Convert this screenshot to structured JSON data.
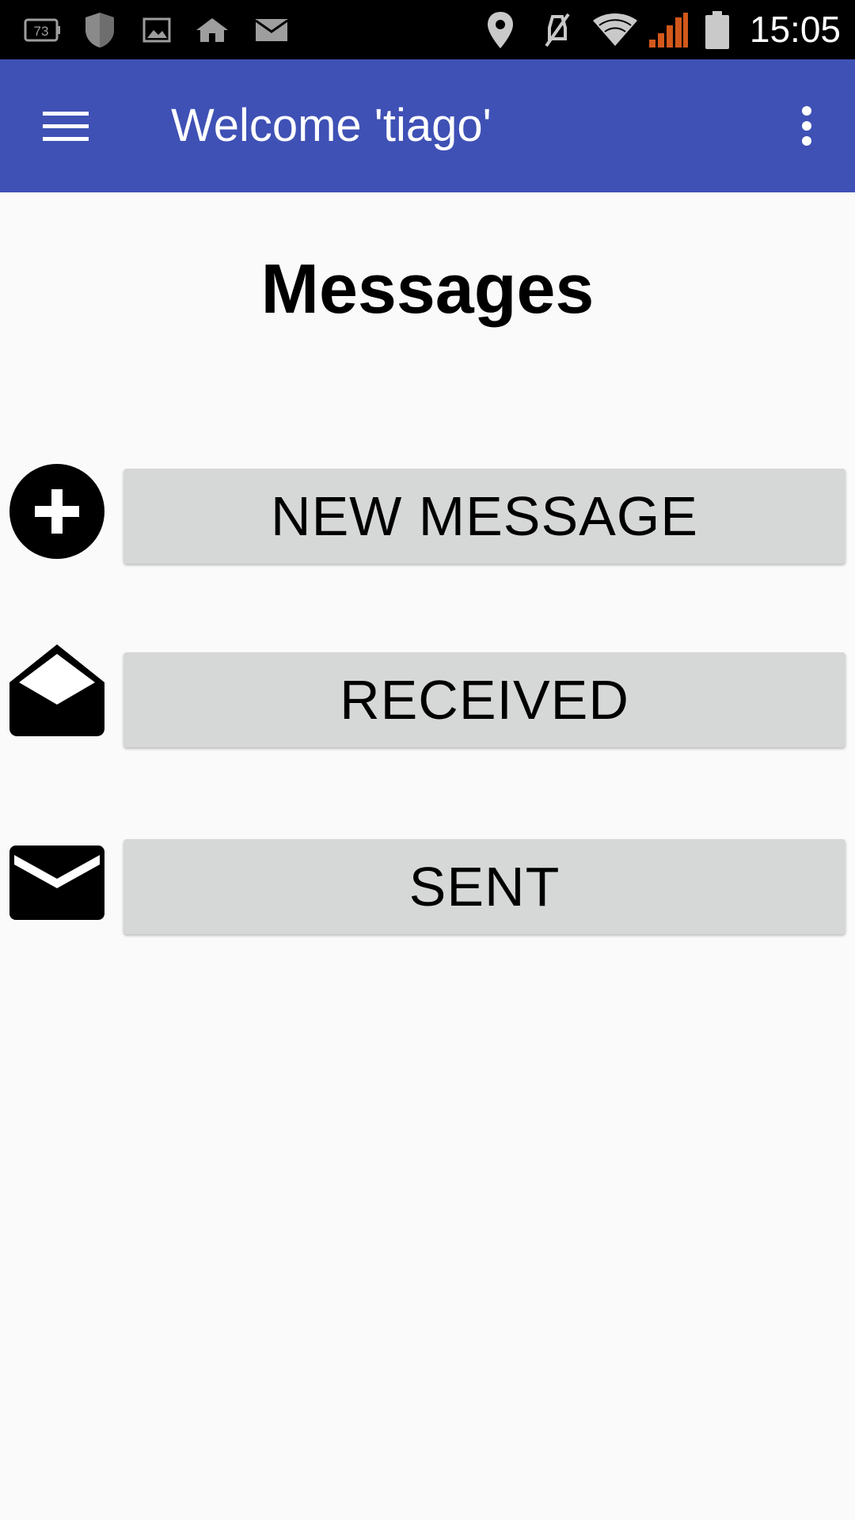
{
  "status_bar": {
    "battery_badge": "73",
    "time": "15:05",
    "icons": [
      "battery-saver-icon",
      "shield-icon",
      "image-icon",
      "home-icon",
      "mail-icon",
      "location-icon",
      "mute-icon",
      "wifi-icon",
      "signal-icon",
      "battery-icon"
    ],
    "signal_color": "#d2581b"
  },
  "app_bar": {
    "title": "Welcome 'tiago'",
    "menu_icon": "hamburger-menu-icon",
    "overflow_icon": "more-vert-icon",
    "color": "#3f51b5"
  },
  "main": {
    "title": "Messages",
    "actions": [
      {
        "label": "NEW MESSAGE",
        "icon": "add-circle-icon"
      },
      {
        "label": "RECEIVED",
        "icon": "envelope-open-icon"
      },
      {
        "label": "SENT",
        "icon": "envelope-closed-icon"
      }
    ]
  }
}
